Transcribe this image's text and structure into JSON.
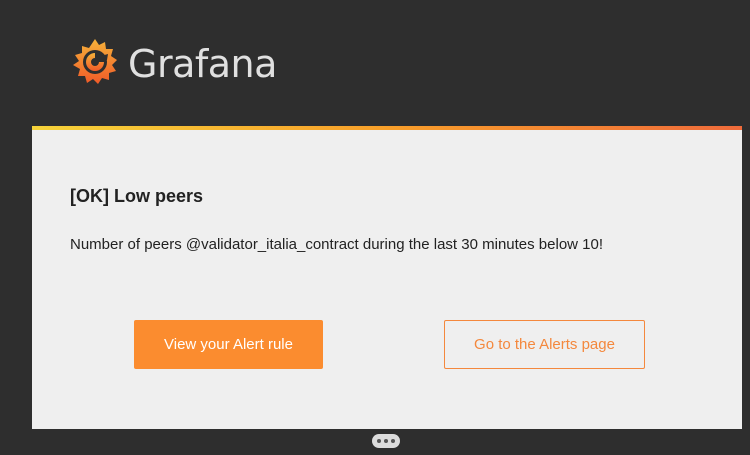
{
  "brand": {
    "name": "Grafana",
    "icon": "grafana-logo-icon"
  },
  "colors": {
    "page_bg": "#2e2e2e",
    "card_bg": "#efefef",
    "accent": "#fb8c2f",
    "accent_bar_start": "#f6d33a",
    "accent_bar_end": "#ef6b3b"
  },
  "alert": {
    "title": "[OK] Low peers",
    "message": "Number of peers @validator_italia_contract during the last 30 minutes below 10!"
  },
  "actions": {
    "view_rule_label": "View your Alert rule",
    "alerts_page_label": "Go to the Alerts page"
  },
  "trimmed_content": {
    "icon": "ellipsis-icon"
  }
}
